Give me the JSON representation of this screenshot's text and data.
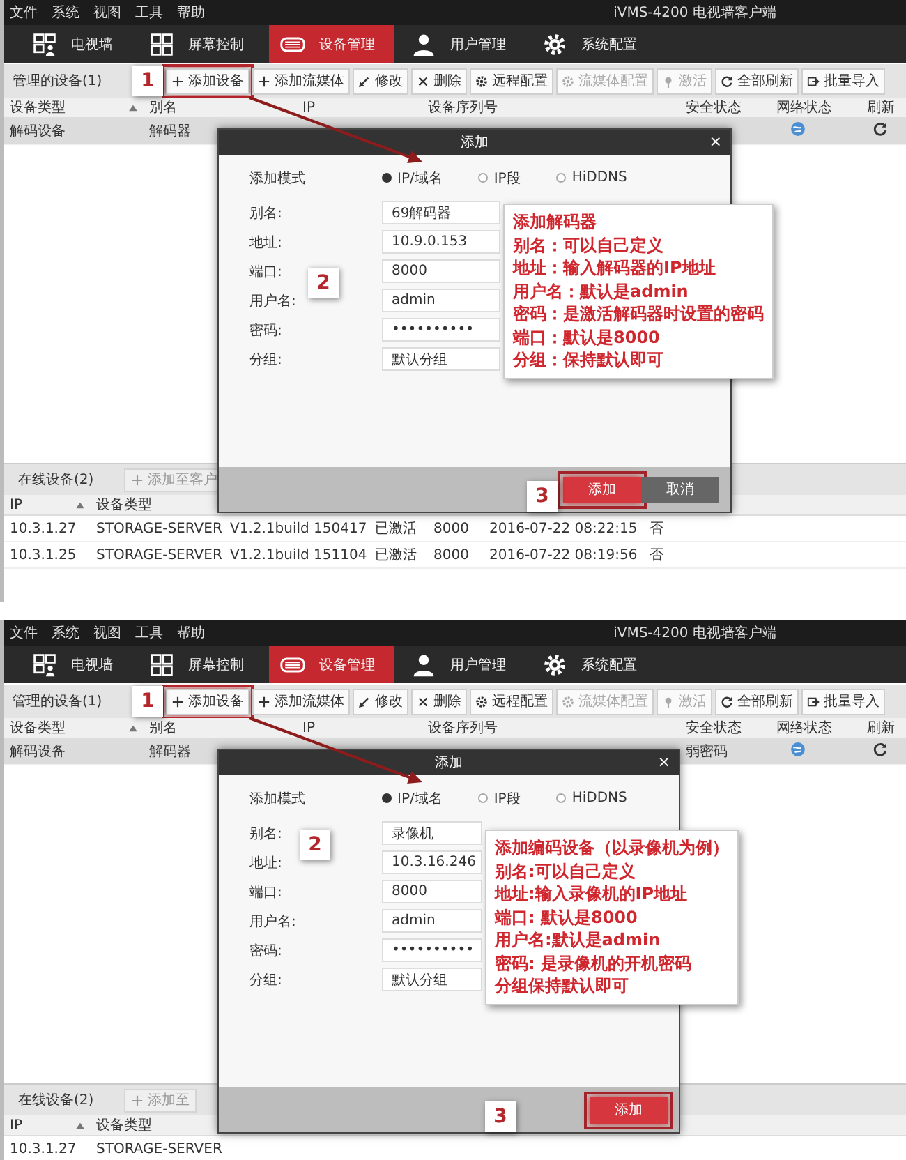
{
  "screenshots": [
    {
      "menu": [
        "文件",
        "系统",
        "视图",
        "工具",
        "帮助"
      ],
      "window_title": "iVMS-4200 电视墙客户端",
      "tabs": [
        {
          "label": "电视墙",
          "kind": "wall",
          "selected": false
        },
        {
          "label": "屏幕控制",
          "kind": "screen",
          "selected": false
        },
        {
          "label": "设备管理",
          "kind": "device",
          "selected": true
        },
        {
          "label": "用户管理",
          "kind": "user",
          "selected": false
        },
        {
          "label": "系统配置",
          "kind": "settings",
          "selected": false
        }
      ],
      "managed_devices": {
        "title": "管理的设备(1)",
        "buttons": [
          {
            "label": "添加设备",
            "kind": "add",
            "disabled": false,
            "highlighted": true
          },
          {
            "label": "添加流媒体",
            "kind": "add",
            "disabled": false,
            "highlighted": false
          },
          {
            "label": "修改",
            "kind": "edit",
            "disabled": false,
            "highlighted": false
          },
          {
            "label": "删除",
            "kind": "delete",
            "disabled": false,
            "highlighted": false
          },
          {
            "label": "远程配置",
            "kind": "config",
            "disabled": false,
            "highlighted": false
          },
          {
            "label": "流媒体配置",
            "kind": "config",
            "disabled": true,
            "highlighted": false
          },
          {
            "label": "激活",
            "kind": "activate",
            "disabled": true,
            "highlighted": false
          },
          {
            "label": "全部刷新",
            "kind": "refresh",
            "disabled": false,
            "highlighted": false
          },
          {
            "label": "批量导入",
            "kind": "import",
            "disabled": false,
            "highlighted": false
          }
        ],
        "columns": [
          "设备类型",
          "别名",
          "IP",
          "设备序列号",
          "安全状态",
          "网络状态",
          "刷新"
        ],
        "rows": [
          {
            "cells": [
              "解码设备",
              "解码器"
            ]
          }
        ]
      },
      "online_devices": {
        "title": "在线设备(2)",
        "add_button": "添加至客户",
        "columns": [
          "IP",
          "设备类型"
        ],
        "rows": [
          {
            "cells": [
              "10.3.1.27",
              "STORAGE-SERVER",
              "V1.2.1build 150417",
              "已激活",
              "8000",
              "2016-07-22 08:22:15",
              "否"
            ]
          },
          {
            "cells": [
              "10.3.1.25",
              "STORAGE-SERVER",
              "V1.2.1build 151104",
              "已激活",
              "8000",
              "2016-07-22 08:19:56",
              "否"
            ]
          }
        ]
      },
      "dialog": {
        "title": "添加",
        "close": "×",
        "mode_label": "添加模式",
        "modes": [
          {
            "label": "IP/域名",
            "selected": true
          },
          {
            "label": "IP段",
            "selected": false
          },
          {
            "label": "HiDDNS",
            "selected": false
          }
        ],
        "fields": [
          {
            "label": "别名:",
            "value": "69解码器"
          },
          {
            "label": "地址:",
            "value": "10.9.0.153"
          },
          {
            "label": "端口:",
            "value": "8000"
          },
          {
            "label": "用户名:",
            "value": "admin"
          },
          {
            "label": "密码:",
            "value": "••••••••••"
          },
          {
            "label": "分组:",
            "value": "默认分组"
          }
        ],
        "buttons": [
          {
            "label": "添加",
            "kind": "primary",
            "highlighted": true
          },
          {
            "label": "取消",
            "kind": "secondary",
            "highlighted": false
          }
        ]
      },
      "callout": {
        "lines": [
          "添加解码器",
          "别名：可以自己定义",
          "地址：输入解码器的IP地址",
          "用户名：默认是admin",
          "密码：是激活解码器时设置的密码",
          "端口：默认是8000",
          "分组：保持默认即可"
        ]
      },
      "steps": [
        "1",
        "2",
        "3"
      ]
    },
    {
      "menu": [
        "文件",
        "系统",
        "视图",
        "工具",
        "帮助"
      ],
      "window_title": "iVMS-4200 电视墙客户端",
      "tabs": [
        {
          "label": "电视墙",
          "kind": "wall",
          "selected": false
        },
        {
          "label": "屏幕控制",
          "kind": "screen",
          "selected": false
        },
        {
          "label": "设备管理",
          "kind": "device",
          "selected": true
        },
        {
          "label": "用户管理",
          "kind": "user",
          "selected": false
        },
        {
          "label": "系统配置",
          "kind": "settings",
          "selected": false
        }
      ],
      "managed_devices": {
        "title": "管理的设备(1)",
        "buttons": [
          {
            "label": "添加设备",
            "kind": "add",
            "disabled": false,
            "highlighted": true
          },
          {
            "label": "添加流媒体",
            "kind": "add",
            "disabled": false,
            "highlighted": false
          },
          {
            "label": "修改",
            "kind": "edit",
            "disabled": false,
            "highlighted": false
          },
          {
            "label": "删除",
            "kind": "delete",
            "disabled": false,
            "highlighted": false
          },
          {
            "label": "远程配置",
            "kind": "config",
            "disabled": false,
            "highlighted": false
          },
          {
            "label": "流媒体配置",
            "kind": "config",
            "disabled": true,
            "highlighted": false
          },
          {
            "label": "激活",
            "kind": "activate",
            "disabled": true,
            "highlighted": false
          },
          {
            "label": "全部刷新",
            "kind": "refresh",
            "disabled": false,
            "highlighted": false
          },
          {
            "label": "批量导入",
            "kind": "import",
            "disabled": false,
            "highlighted": false
          }
        ],
        "columns": [
          "设备类型",
          "别名",
          "IP",
          "设备序列号",
          "安全状态",
          "网络状态",
          "刷新"
        ],
        "rows": [
          {
            "cells": [
              "解码设备",
              "解码器"
            ],
            "security": "弱密码"
          }
        ]
      },
      "online_devices": {
        "title": "在线设备(2)",
        "add_button": "添加至",
        "columns": [
          "IP",
          "设备类型"
        ],
        "rows": [
          {
            "cells": [
              "10.3.1.27",
              "STORAGE-SERVER"
            ]
          }
        ]
      },
      "dialog": {
        "title": "添加",
        "close": "×",
        "mode_label": "添加模式",
        "modes": [
          {
            "label": "IP/域名",
            "selected": true
          },
          {
            "label": "IP段",
            "selected": false
          },
          {
            "label": "HiDDNS",
            "selected": false
          }
        ],
        "fields": [
          {
            "label": "别名:",
            "value": "录像机"
          },
          {
            "label": "地址:",
            "value": "10.3.16.246"
          },
          {
            "label": "端口:",
            "value": "8000"
          },
          {
            "label": "用户名:",
            "value": "admin"
          },
          {
            "label": "密码:",
            "value": "••••••••••"
          },
          {
            "label": "分组:",
            "value": "默认分组"
          }
        ],
        "buttons": [
          {
            "label": "添加",
            "kind": "primary",
            "highlighted": true
          }
        ]
      },
      "callout": {
        "lines": [
          "添加编码设备（以录像机为例）",
          "别名:可以自己定义",
          "地址:输入录像机的IP地址",
          "端口: 默认是8000",
          "用户名:默认是admin",
          "密码: 是录像机的开机密码",
          "分组保持默认即可"
        ]
      },
      "steps": [
        "1",
        "2",
        "3"
      ]
    }
  ]
}
